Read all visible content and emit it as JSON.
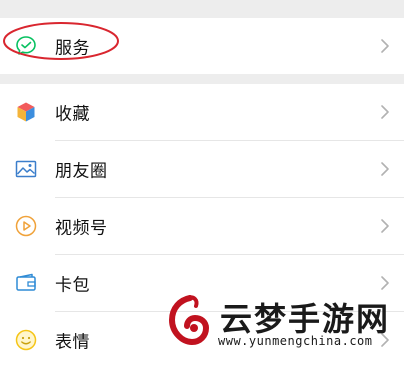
{
  "menu_groups": [
    {
      "items": [
        {
          "label": "服务",
          "icon": "service-icon",
          "highlighted": true
        }
      ]
    },
    {
      "items": [
        {
          "label": "收藏",
          "icon": "favorites-icon"
        },
        {
          "label": "朋友圈",
          "icon": "moments-icon"
        },
        {
          "label": "视频号",
          "icon": "channels-icon"
        },
        {
          "label": "卡包",
          "icon": "card-wallet-icon"
        },
        {
          "label": "表情",
          "icon": "emoji-icon"
        }
      ]
    }
  ],
  "watermark": {
    "title": "云梦手游网",
    "url": "www.yunmengchina.com"
  },
  "colors": {
    "background": "#ededed",
    "row_background": "#ffffff",
    "highlight_oval": "#d9262f",
    "chevron": "#b2b2b2",
    "service_icon": "#07c160",
    "moments_icon": "#3b7ecb",
    "channels_icon": "#f0a23a",
    "card_icon": "#2f8bd5",
    "emoji_icon": "#f5c518"
  }
}
